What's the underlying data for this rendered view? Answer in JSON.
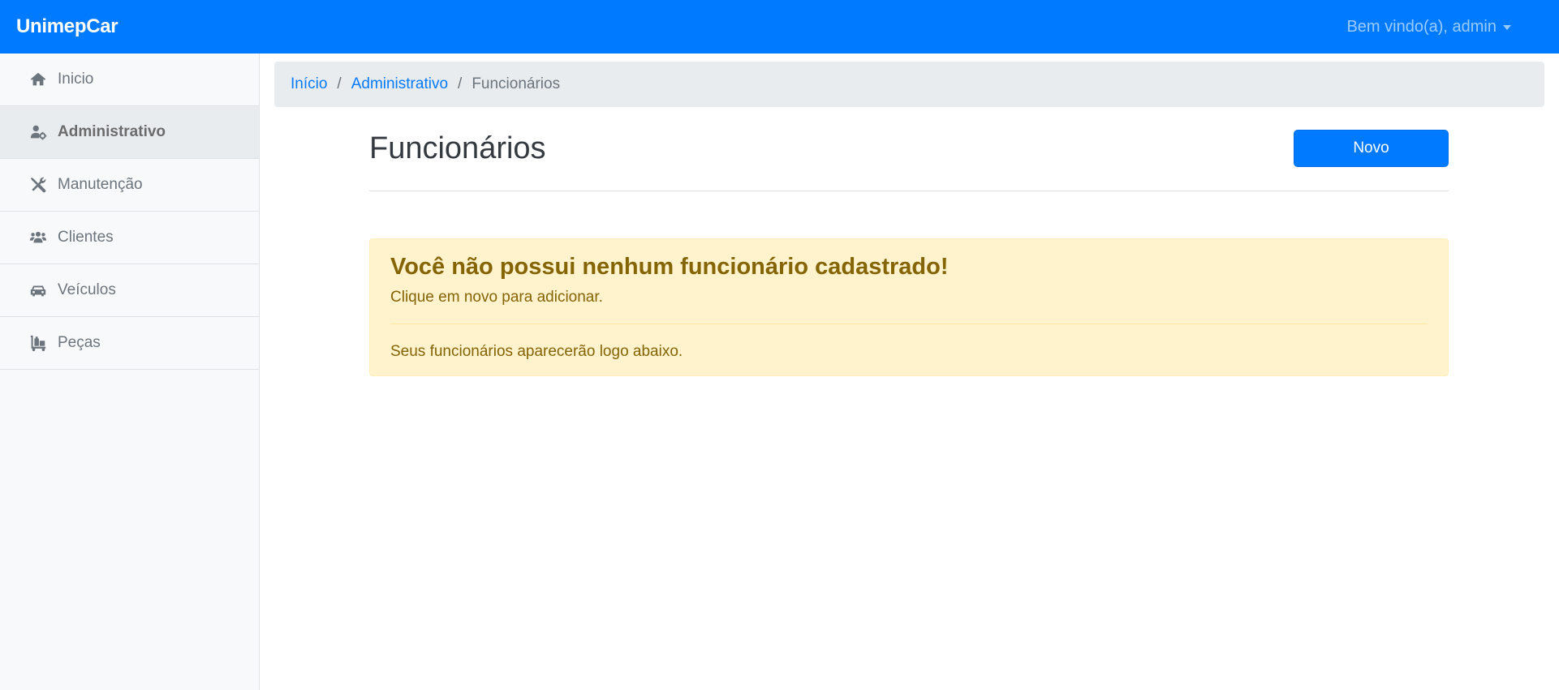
{
  "navbar": {
    "brand": "UnimepCar",
    "user_menu": "Bem vindo(a), admin"
  },
  "sidebar": {
    "items": [
      {
        "label": "Inicio",
        "icon": "home-icon"
      },
      {
        "label": "Administrativo",
        "icon": "user-cog-icon",
        "active": true
      },
      {
        "label": "Manutenção",
        "icon": "tools-icon"
      },
      {
        "label": "Clientes",
        "icon": "users-icon"
      },
      {
        "label": "Veículos",
        "icon": "car-icon"
      },
      {
        "label": "Peças",
        "icon": "dolly-icon"
      }
    ]
  },
  "breadcrumb": {
    "items": [
      "Início",
      "Administrativo"
    ],
    "separator": "/",
    "current": "Funcionários"
  },
  "page": {
    "title": "Funcionários",
    "new_button": "Novo"
  },
  "alert": {
    "heading": "Você não possui nenhum funcionário cadastrado!",
    "subtext": "Clique em novo para adicionar.",
    "footer": "Seus funcionários aparecerão logo abaixo."
  },
  "colors": {
    "primary": "#007bff",
    "sidebar_bg": "#f8f9fa",
    "breadcrumb_bg": "#e9ecef",
    "alert_bg": "#fff3cd",
    "alert_text": "#856404"
  }
}
